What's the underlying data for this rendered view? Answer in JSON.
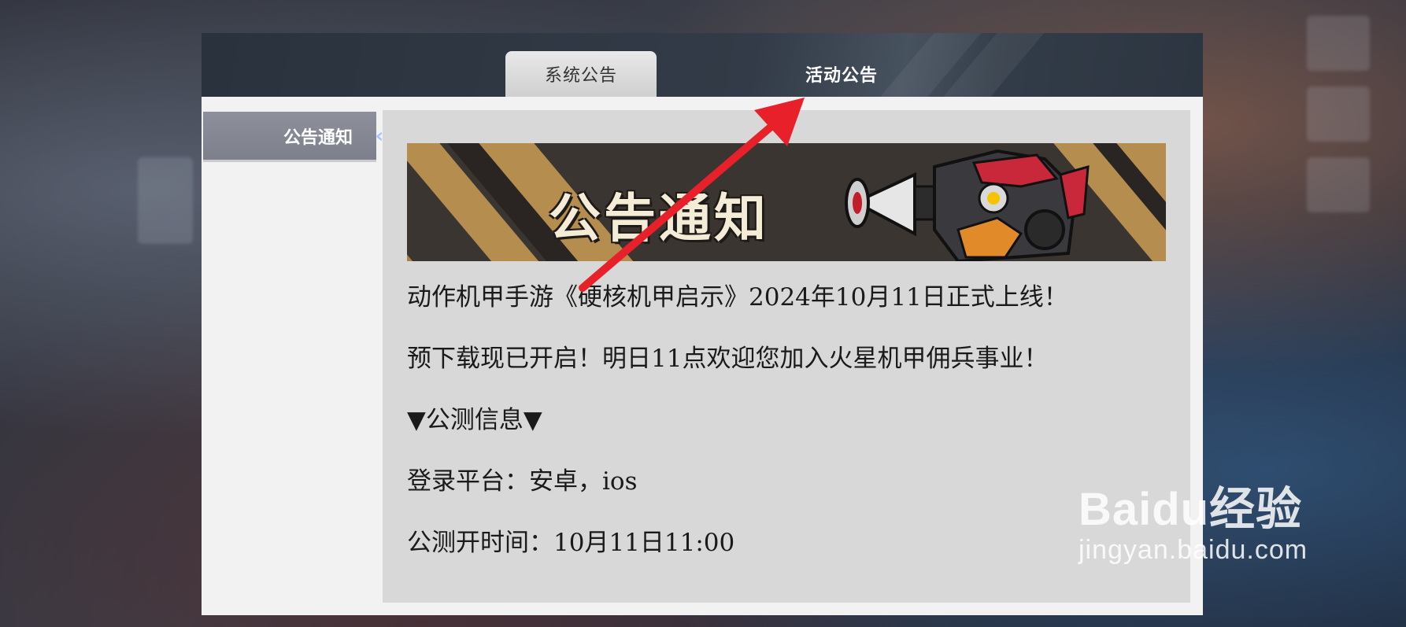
{
  "tabs": {
    "system": "系统公告",
    "activity": "活动公告"
  },
  "sidebar": {
    "item_label": "公告通知"
  },
  "banner": {
    "title": "公告通知"
  },
  "content": {
    "lines": [
      "动作机甲手游《硬核机甲启示》2024年10月11日正式上线！",
      "预下载现已开启！明日11点欢迎您加入火星机甲佣兵事业！",
      "▼公测信息▼",
      "登录平台：安卓，ios",
      "公测开时间：10月11日11:00"
    ]
  },
  "watermark": {
    "brand": "Baidu经验",
    "url": "jingyan.baidu.com"
  },
  "colors": {
    "arrow": "#e8202a",
    "header": "#2c3540",
    "content_bg": "#d8d8d8"
  }
}
